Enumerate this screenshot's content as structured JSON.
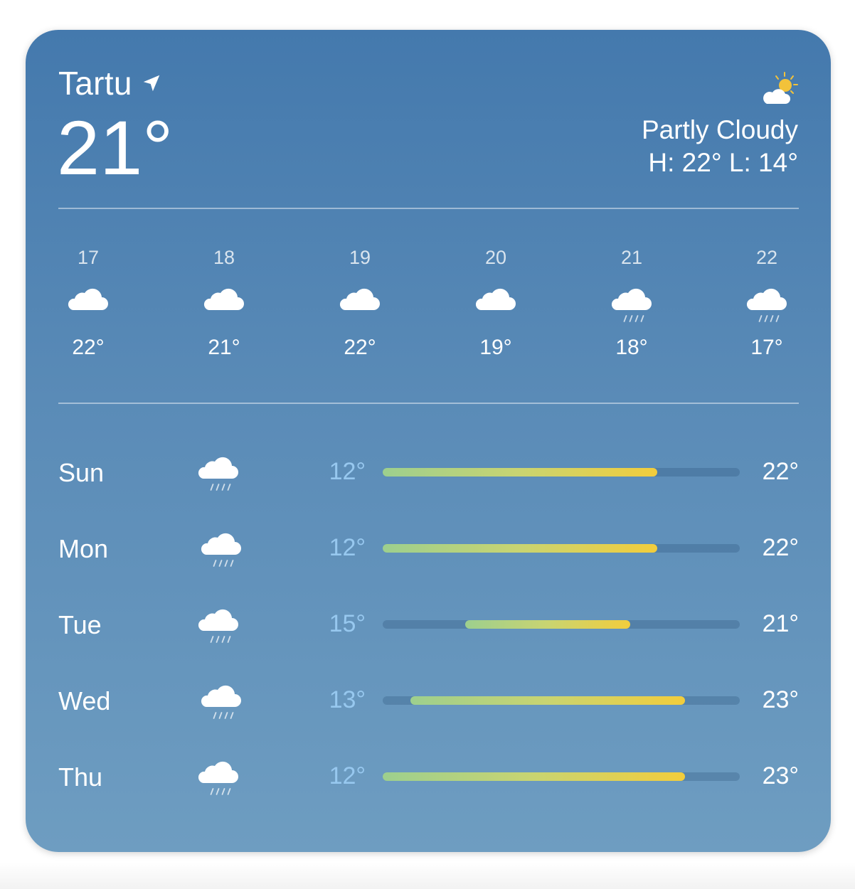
{
  "location": {
    "city": "Tartu",
    "icon": "location-arrow-icon"
  },
  "current": {
    "temp": "21°",
    "condition": "Partly Cloudy",
    "high_low": "H: 22° L: 14°",
    "icon": "partly-cloudy-icon"
  },
  "hourly": [
    {
      "time": "17",
      "icon": "cloud-icon",
      "temp": "22°"
    },
    {
      "time": "18",
      "icon": "cloud-icon",
      "temp": "21°"
    },
    {
      "time": "19",
      "icon": "cloud-icon",
      "temp": "22°"
    },
    {
      "time": "20",
      "icon": "cloud-icon",
      "temp": "19°"
    },
    {
      "time": "21",
      "icon": "cloud-rain-icon",
      "temp": "18°"
    },
    {
      "time": "22",
      "icon": "cloud-rain-icon",
      "temp": "17°"
    }
  ],
  "daily": [
    {
      "day": "Sun",
      "icon": "cloud-rain-icon",
      "low": "12°",
      "high": "22°",
      "low_value": 12,
      "high_value": 22
    },
    {
      "day": "Mon",
      "icon": "cloud-rain-icon",
      "low": "12°",
      "high": "22°",
      "low_value": 12,
      "high_value": 22
    },
    {
      "day": "Tue",
      "icon": "cloud-rain-icon",
      "low": "15°",
      "high": "21°",
      "low_value": 15,
      "high_value": 21
    },
    {
      "day": "Wed",
      "icon": "cloud-rain-icon",
      "low": "13°",
      "high": "23°",
      "low_value": 13,
      "high_value": 23
    },
    {
      "day": "Thu",
      "icon": "cloud-rain-icon",
      "low": "12°",
      "high": "23°",
      "low_value": 12,
      "high_value": 23
    }
  ],
  "range_scale": {
    "min": 12,
    "max": 25
  },
  "colors": {
    "background_top": "#4479ad",
    "background_bottom": "#6e9dc1",
    "low_temp_text": "#97c8ef",
    "bar_cool": "#9dcf8e",
    "bar_warm": "#f2cd3c"
  }
}
